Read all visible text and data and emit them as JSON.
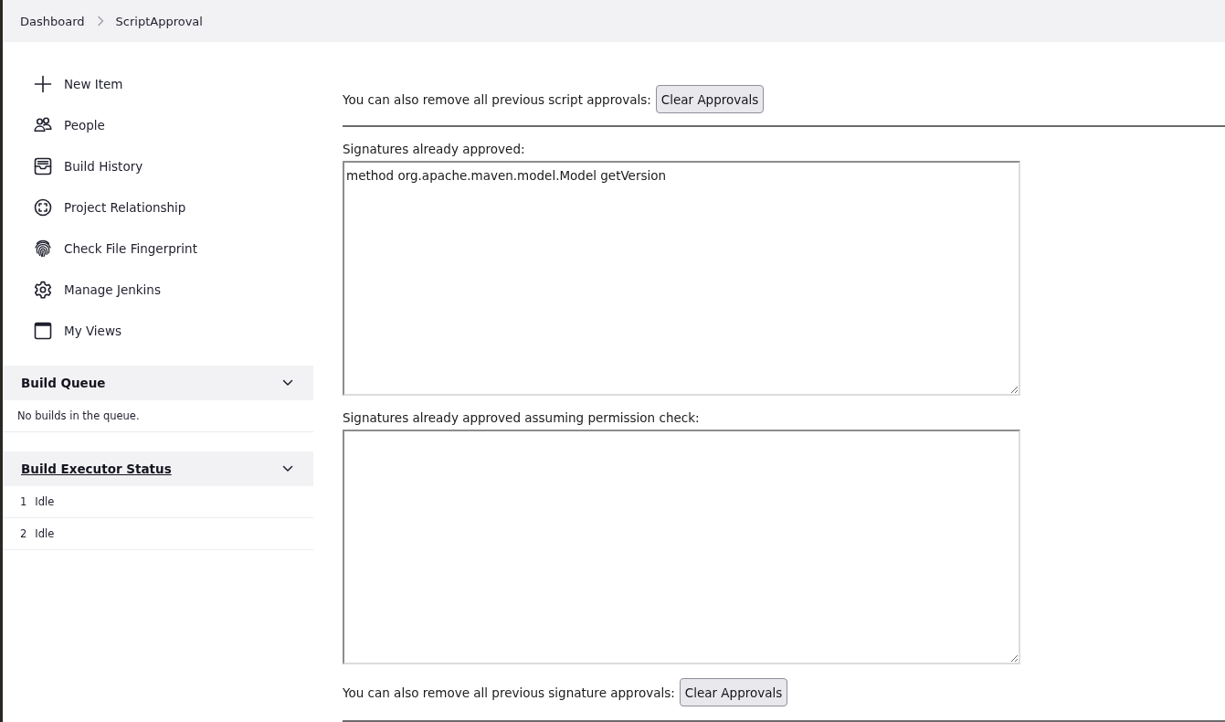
{
  "breadcrumbs": [
    {
      "label": "Dashboard"
    },
    {
      "label": "ScriptApproval"
    }
  ],
  "sidebar": {
    "items": [
      {
        "label": "New Item"
      },
      {
        "label": "People"
      },
      {
        "label": "Build History"
      },
      {
        "label": "Project Relationship"
      },
      {
        "label": "Check File Fingerprint"
      },
      {
        "label": "Manage Jenkins"
      },
      {
        "label": "My Views"
      }
    ]
  },
  "build_queue": {
    "title": "Build Queue",
    "expanded": true,
    "message": "No builds in the queue."
  },
  "build_executor_status": {
    "title": "Build Executor Status",
    "expanded": true,
    "executors": [
      {
        "number": "1",
        "status": "Idle"
      },
      {
        "number": "2",
        "status": "Idle"
      }
    ]
  },
  "main": {
    "script_approvals": {
      "text": "You can also remove all previous script approvals:",
      "button": "Clear Approvals"
    },
    "approved_signatures": {
      "label": "Signatures already approved:",
      "value": "method org.apache.maven.model.Model getVersion"
    },
    "approved_signatures_permission_check": {
      "label": "Signatures already approved assuming permission check:"
    },
    "signature_approvals": {
      "text": "You can also remove all previous signature approvals:",
      "button": "Clear Approvals"
    }
  }
}
